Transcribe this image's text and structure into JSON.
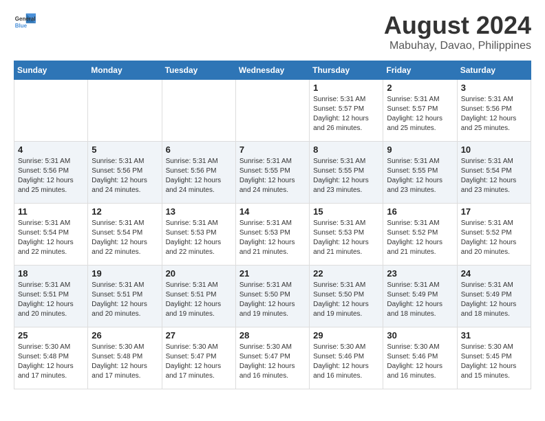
{
  "header": {
    "logo_line1": "General",
    "logo_line2": "Blue",
    "title": "August 2024",
    "subtitle": "Mabuhay, Davao, Philippines"
  },
  "days_of_week": [
    "Sunday",
    "Monday",
    "Tuesday",
    "Wednesday",
    "Thursday",
    "Friday",
    "Saturday"
  ],
  "weeks": [
    [
      {
        "day": "",
        "info": ""
      },
      {
        "day": "",
        "info": ""
      },
      {
        "day": "",
        "info": ""
      },
      {
        "day": "",
        "info": ""
      },
      {
        "day": "1",
        "info": "Sunrise: 5:31 AM\nSunset: 5:57 PM\nDaylight: 12 hours\nand 26 minutes."
      },
      {
        "day": "2",
        "info": "Sunrise: 5:31 AM\nSunset: 5:57 PM\nDaylight: 12 hours\nand 25 minutes."
      },
      {
        "day": "3",
        "info": "Sunrise: 5:31 AM\nSunset: 5:56 PM\nDaylight: 12 hours\nand 25 minutes."
      }
    ],
    [
      {
        "day": "4",
        "info": "Sunrise: 5:31 AM\nSunset: 5:56 PM\nDaylight: 12 hours\nand 25 minutes."
      },
      {
        "day": "5",
        "info": "Sunrise: 5:31 AM\nSunset: 5:56 PM\nDaylight: 12 hours\nand 24 minutes."
      },
      {
        "day": "6",
        "info": "Sunrise: 5:31 AM\nSunset: 5:56 PM\nDaylight: 12 hours\nand 24 minutes."
      },
      {
        "day": "7",
        "info": "Sunrise: 5:31 AM\nSunset: 5:55 PM\nDaylight: 12 hours\nand 24 minutes."
      },
      {
        "day": "8",
        "info": "Sunrise: 5:31 AM\nSunset: 5:55 PM\nDaylight: 12 hours\nand 23 minutes."
      },
      {
        "day": "9",
        "info": "Sunrise: 5:31 AM\nSunset: 5:55 PM\nDaylight: 12 hours\nand 23 minutes."
      },
      {
        "day": "10",
        "info": "Sunrise: 5:31 AM\nSunset: 5:54 PM\nDaylight: 12 hours\nand 23 minutes."
      }
    ],
    [
      {
        "day": "11",
        "info": "Sunrise: 5:31 AM\nSunset: 5:54 PM\nDaylight: 12 hours\nand 22 minutes."
      },
      {
        "day": "12",
        "info": "Sunrise: 5:31 AM\nSunset: 5:54 PM\nDaylight: 12 hours\nand 22 minutes."
      },
      {
        "day": "13",
        "info": "Sunrise: 5:31 AM\nSunset: 5:53 PM\nDaylight: 12 hours\nand 22 minutes."
      },
      {
        "day": "14",
        "info": "Sunrise: 5:31 AM\nSunset: 5:53 PM\nDaylight: 12 hours\nand 21 minutes."
      },
      {
        "day": "15",
        "info": "Sunrise: 5:31 AM\nSunset: 5:53 PM\nDaylight: 12 hours\nand 21 minutes."
      },
      {
        "day": "16",
        "info": "Sunrise: 5:31 AM\nSunset: 5:52 PM\nDaylight: 12 hours\nand 21 minutes."
      },
      {
        "day": "17",
        "info": "Sunrise: 5:31 AM\nSunset: 5:52 PM\nDaylight: 12 hours\nand 20 minutes."
      }
    ],
    [
      {
        "day": "18",
        "info": "Sunrise: 5:31 AM\nSunset: 5:51 PM\nDaylight: 12 hours\nand 20 minutes."
      },
      {
        "day": "19",
        "info": "Sunrise: 5:31 AM\nSunset: 5:51 PM\nDaylight: 12 hours\nand 20 minutes."
      },
      {
        "day": "20",
        "info": "Sunrise: 5:31 AM\nSunset: 5:51 PM\nDaylight: 12 hours\nand 19 minutes."
      },
      {
        "day": "21",
        "info": "Sunrise: 5:31 AM\nSunset: 5:50 PM\nDaylight: 12 hours\nand 19 minutes."
      },
      {
        "day": "22",
        "info": "Sunrise: 5:31 AM\nSunset: 5:50 PM\nDaylight: 12 hours\nand 19 minutes."
      },
      {
        "day": "23",
        "info": "Sunrise: 5:31 AM\nSunset: 5:49 PM\nDaylight: 12 hours\nand 18 minutes."
      },
      {
        "day": "24",
        "info": "Sunrise: 5:31 AM\nSunset: 5:49 PM\nDaylight: 12 hours\nand 18 minutes."
      }
    ],
    [
      {
        "day": "25",
        "info": "Sunrise: 5:30 AM\nSunset: 5:48 PM\nDaylight: 12 hours\nand 17 minutes."
      },
      {
        "day": "26",
        "info": "Sunrise: 5:30 AM\nSunset: 5:48 PM\nDaylight: 12 hours\nand 17 minutes."
      },
      {
        "day": "27",
        "info": "Sunrise: 5:30 AM\nSunset: 5:47 PM\nDaylight: 12 hours\nand 17 minutes."
      },
      {
        "day": "28",
        "info": "Sunrise: 5:30 AM\nSunset: 5:47 PM\nDaylight: 12 hours\nand 16 minutes."
      },
      {
        "day": "29",
        "info": "Sunrise: 5:30 AM\nSunset: 5:46 PM\nDaylight: 12 hours\nand 16 minutes."
      },
      {
        "day": "30",
        "info": "Sunrise: 5:30 AM\nSunset: 5:46 PM\nDaylight: 12 hours\nand 16 minutes."
      },
      {
        "day": "31",
        "info": "Sunrise: 5:30 AM\nSunset: 5:45 PM\nDaylight: 12 hours\nand 15 minutes."
      }
    ]
  ]
}
